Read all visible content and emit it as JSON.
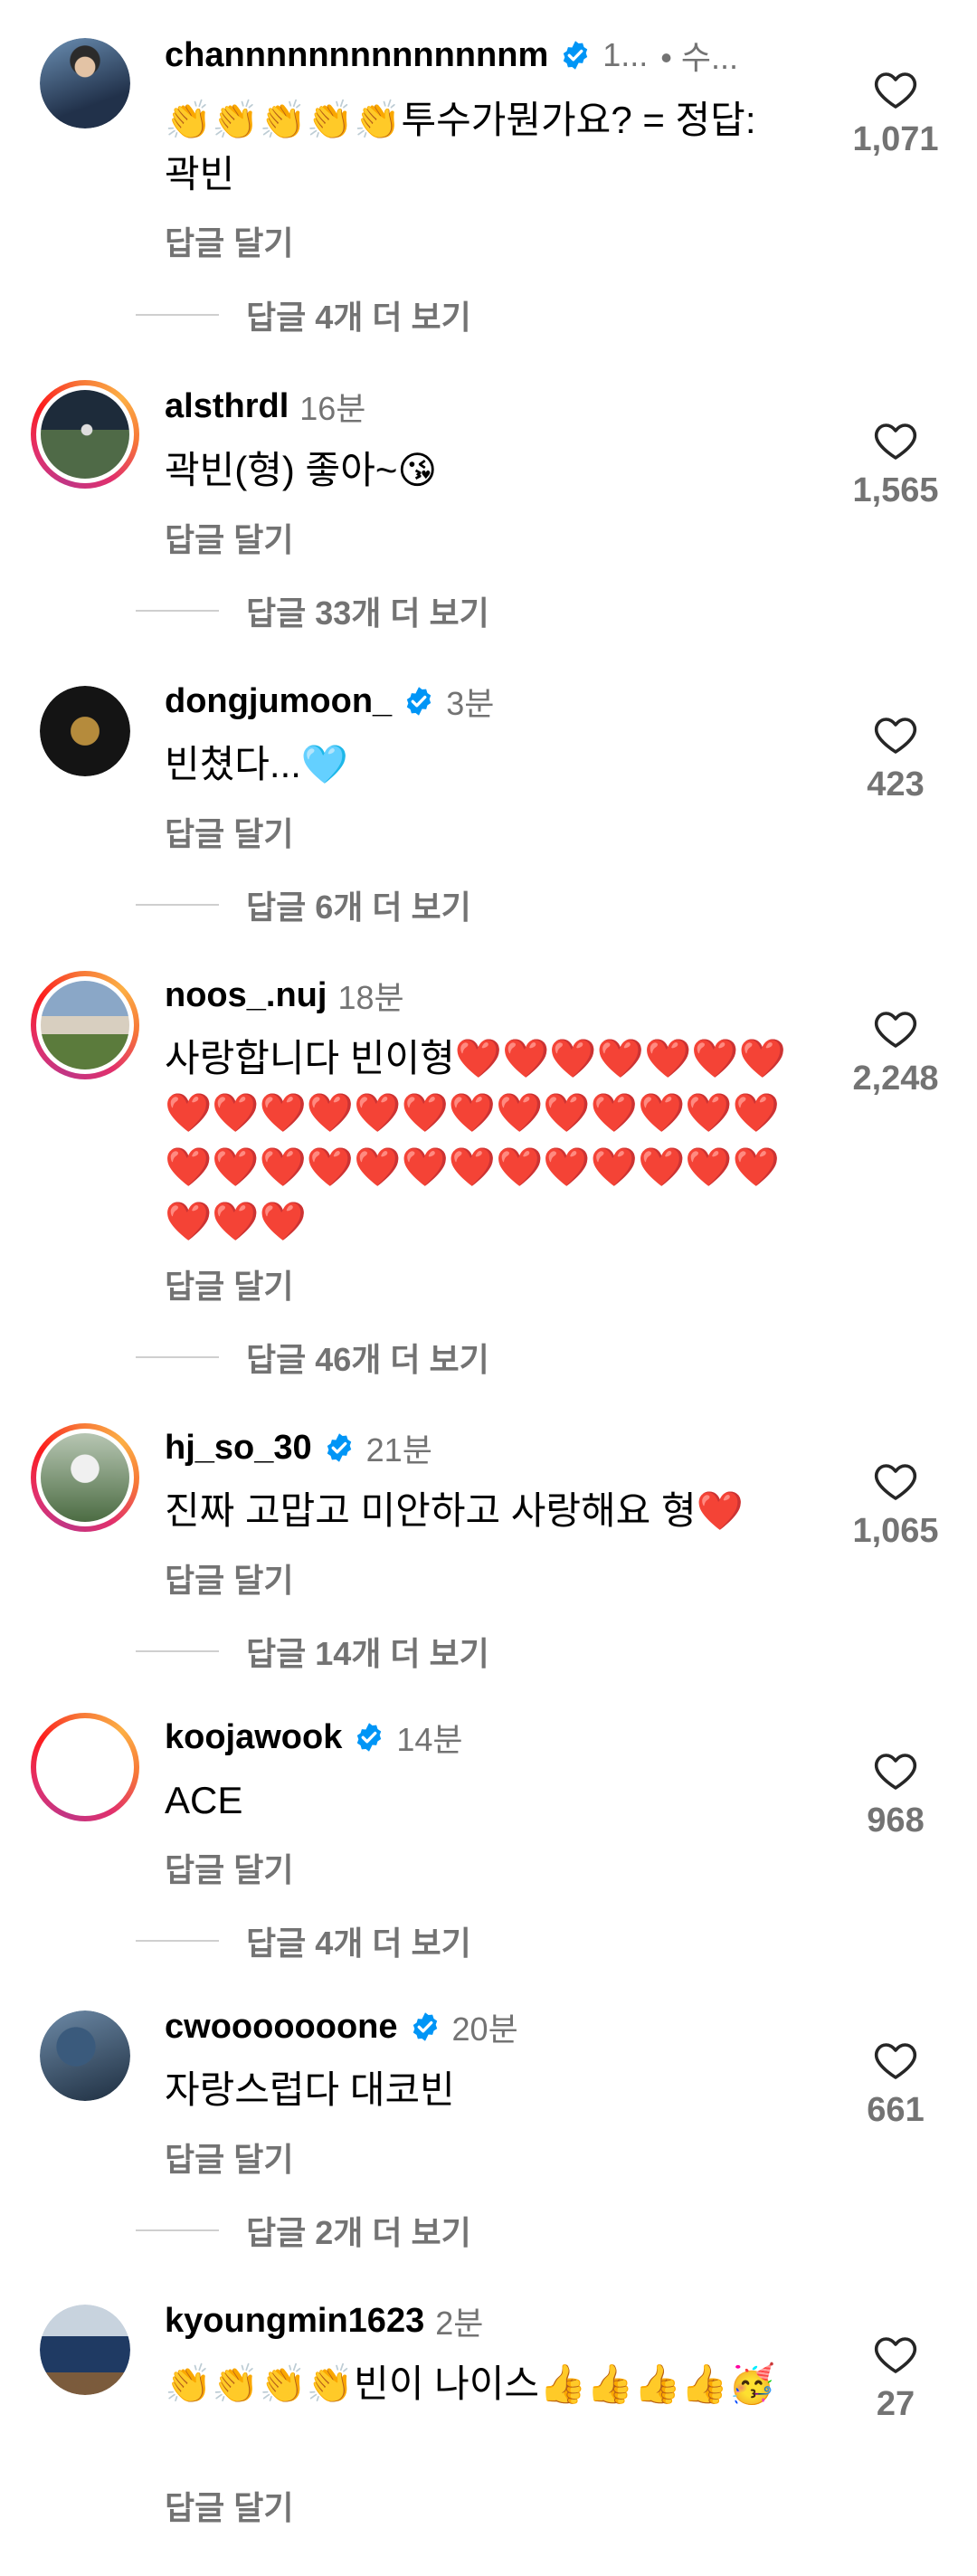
{
  "colors": {
    "text": "#000000",
    "secondary": "#737373",
    "verified": "#0095f6"
  },
  "reply_label": "답글 달기",
  "comments": [
    {
      "username": "channnnnnnnnnnnnnm",
      "verified": true,
      "time": "1...",
      "extra": "• 수...",
      "text": "👏👏👏👏👏투수가뭔가요? = 정답:곽빈",
      "likes": "1,071",
      "more_replies": "답글 4개 더 보기",
      "avatar": "profile-photo"
    },
    {
      "username": "alsthrdl",
      "verified": false,
      "time": "16분",
      "text": "곽빈(형) 좋아~😘",
      "likes": "1,565",
      "more_replies": "답글 33개 더 보기",
      "avatar": "profile-photo"
    },
    {
      "username": "dongjumoon_",
      "verified": true,
      "time": "3분",
      "text": "빈쳤다...🩵",
      "likes": "423",
      "more_replies": "답글 6개 더 보기",
      "avatar": "profile-logo"
    },
    {
      "username": "noos_.nuj",
      "verified": false,
      "time": "18분",
      "text": "사랑합니다 빈이형❤️❤️❤️❤️❤️❤️❤️❤️❤️❤️❤️❤️❤️❤️❤️❤️❤️❤️❤️❤️❤️❤️❤️❤️❤️❤️❤️❤️❤️❤️❤️❤️❤️❤️❤️❤️",
      "likes": "2,248",
      "more_replies": "답글 46개 더 보기",
      "avatar": "profile-photo"
    },
    {
      "username": "hj_so_30",
      "verified": true,
      "time": "21분",
      "text": "진짜 고맙고 미안하고 사랑해요 형❤️",
      "likes": "1,065",
      "more_replies": "답글 14개 더 보기",
      "avatar": "profile-photo"
    },
    {
      "username": "koojawook",
      "verified": true,
      "time": "14분",
      "text": "ACE",
      "likes": "968",
      "more_replies": "답글 4개 더 보기",
      "avatar": "profile-blank"
    },
    {
      "username": "cwooooooone",
      "verified": true,
      "time": "20분",
      "text": "자랑스럽다 대코빈",
      "likes": "661",
      "more_replies": "답글 2개 더 보기",
      "avatar": "profile-photo"
    },
    {
      "username": "kyoungmin1623",
      "verified": false,
      "time": "2분",
      "text": "👏👏👏👏빈이 나이스👍👍👍👍🥳",
      "likes": "27",
      "more_replies": "",
      "avatar": "profile-photo"
    }
  ]
}
